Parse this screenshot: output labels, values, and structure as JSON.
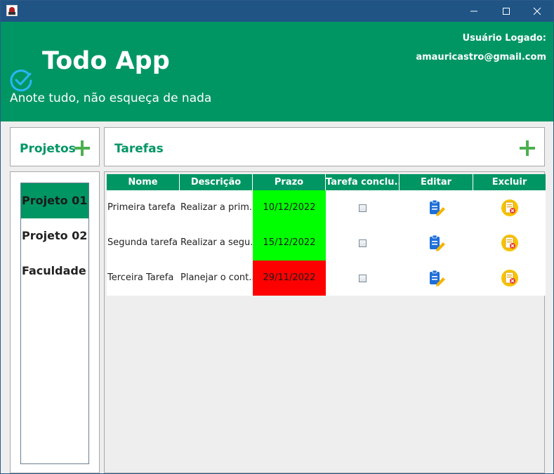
{
  "window": {
    "controls": {
      "minimize": "minimize-icon",
      "maximize": "maximize-icon",
      "close": "close-icon"
    }
  },
  "header": {
    "title": "Todo App",
    "subtitle": "Anote tudo, não esqueça de nada",
    "user_label": "Usuário Logado:",
    "user_email": "amauricastro@gmail.com",
    "icon": "check-circle-icon"
  },
  "projects": {
    "title": "Projetos",
    "items": [
      {
        "label": "Projeto 01",
        "selected": true
      },
      {
        "label": "Projeto 02",
        "selected": false
      },
      {
        "label": "Faculdade",
        "selected": false
      }
    ]
  },
  "tasks": {
    "title": "Tarefas",
    "columns": [
      "Nome",
      "Descrição",
      "Prazo",
      "Tarefa conclu...",
      "Editar",
      "Excluir"
    ],
    "rows": [
      {
        "name": "Primeira tarefa",
        "description": "Realizar a prim...",
        "deadline": "10/12/2022",
        "deadline_color": "#00ff00",
        "done": false
      },
      {
        "name": "Segunda tarefa",
        "description": "Realizar a segu...",
        "deadline": "15/12/2022",
        "deadline_color": "#00ff00",
        "done": false
      },
      {
        "name": "Terceira Tarefa",
        "description": "Planejar o cont...",
        "deadline": "29/11/2022",
        "deadline_color": "#ff0000",
        "done": false
      }
    ]
  },
  "colors": {
    "brand": "#009663",
    "titlebar": "#1f5485",
    "accent_plus": "#4caf50",
    "check_icon": "#29b6f6"
  }
}
